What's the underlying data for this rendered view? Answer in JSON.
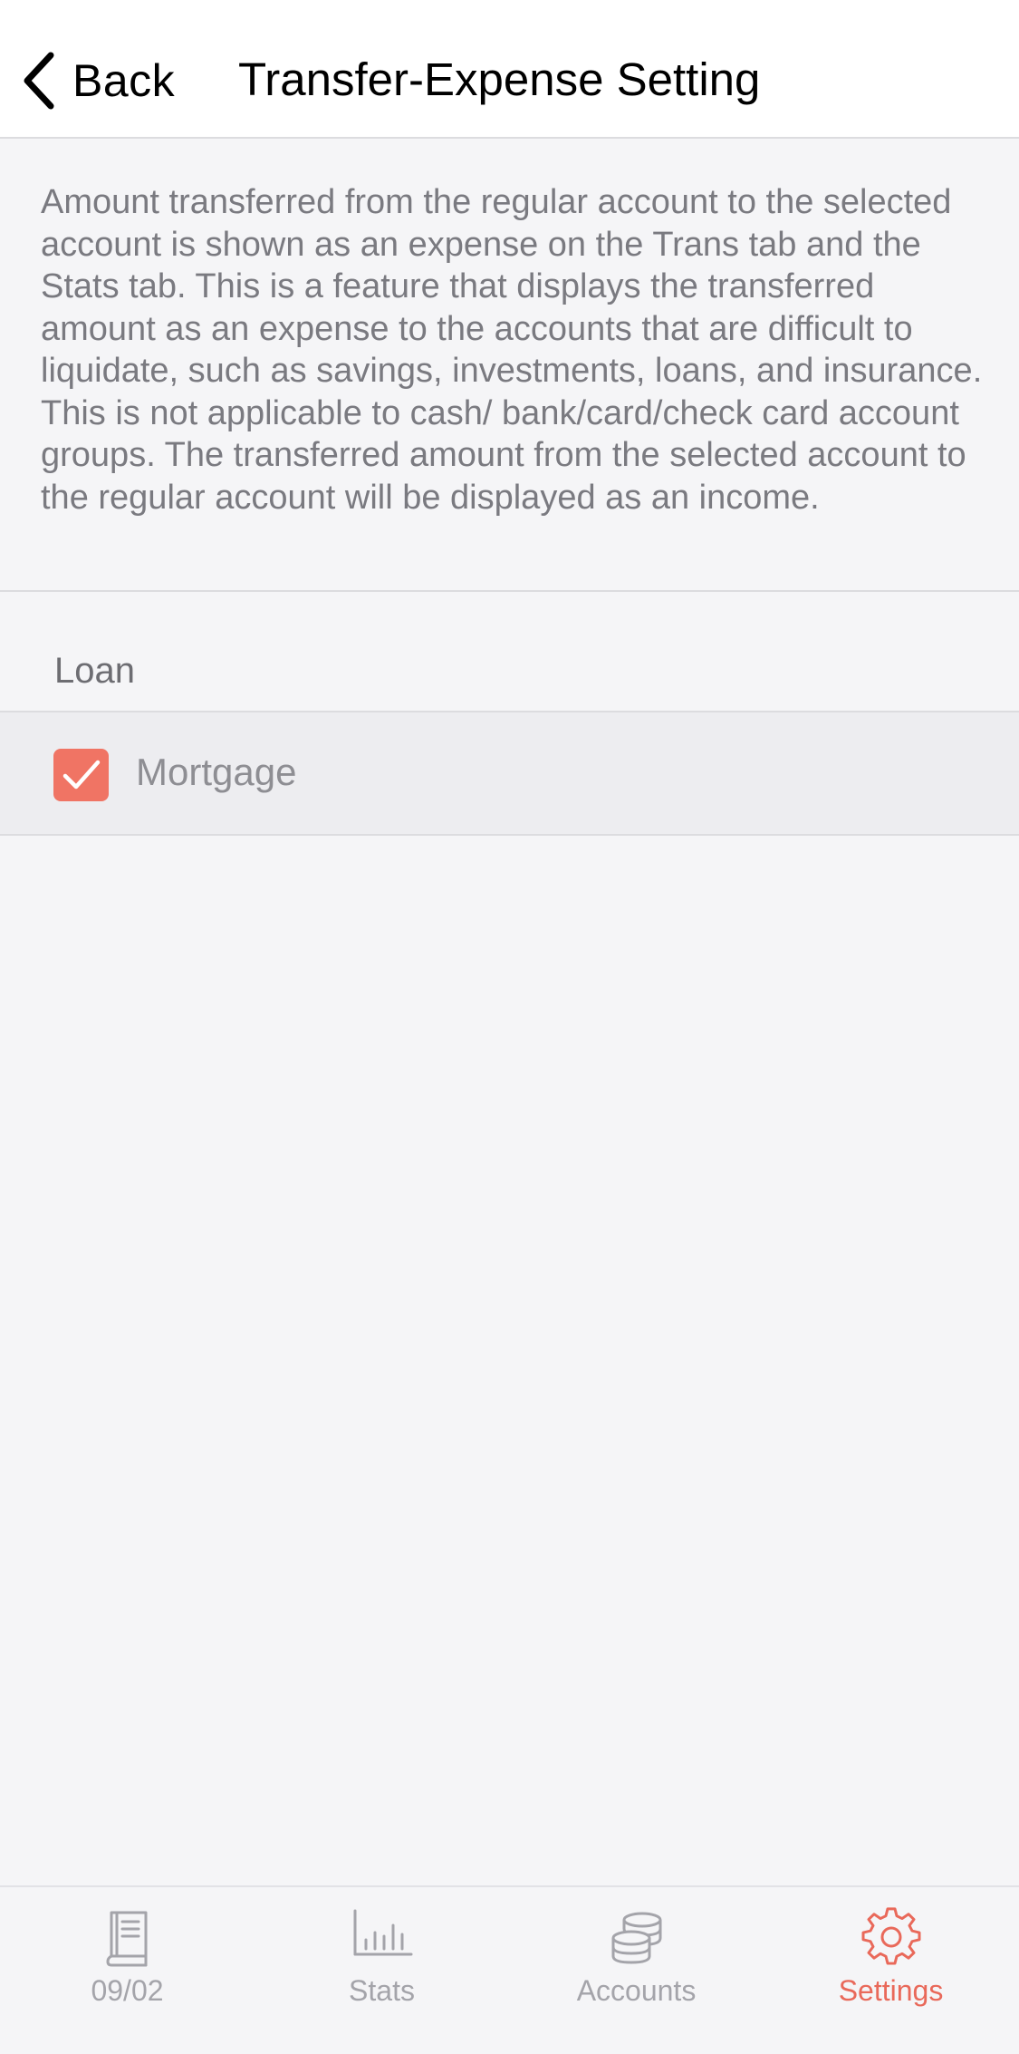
{
  "nav": {
    "back_label": "Back",
    "title": "Transfer-Expense Setting"
  },
  "description": "Amount transferred from the regular account to the selected account is shown as an expense on the Trans tab and the Stats tab. This is a feature that displays the transferred amount as an expense to the accounts that are difficult to liquidate, such as savings, investments, loans, and insurance. This is not applicable to cash/ bank/card/check card account groups. The transferred amount from the selected account to the regular account will be displayed as an income.",
  "section": {
    "header": "Loan",
    "items": [
      {
        "label": "Mortgage",
        "checked": true
      }
    ]
  },
  "tabs": [
    {
      "label": "09/02",
      "icon": "book-icon",
      "active": false
    },
    {
      "label": "Stats",
      "icon": "bar-chart-icon",
      "active": false
    },
    {
      "label": "Accounts",
      "icon": "coins-icon",
      "active": false
    },
    {
      "label": "Settings",
      "icon": "gear-icon",
      "active": true
    }
  ],
  "colors": {
    "accent": "#f07464",
    "active_tab": "#e9695a",
    "inactive_tab": "#a4a4aa",
    "background": "#f5f5f7"
  }
}
